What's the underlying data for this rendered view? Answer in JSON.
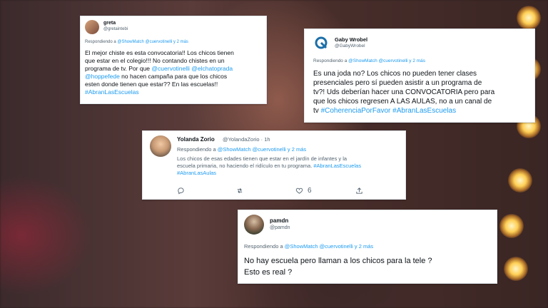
{
  "tweets": {
    "greta": {
      "name": "greta",
      "handle": "@gretaintebi",
      "replying": "Respondiendo a",
      "mentions": "@ShowMatch @cuervotinelli y 2 más",
      "line1": "El mejor chiste es esta convocatoria!! Los chicos tienen",
      "line2": "que estar en el colegio!!! No contando chistes en un",
      "line3_a": "programa de tv. Por que ",
      "line3_m1": "@cuervotinelli",
      "line3_m2": "@elchatoprada",
      "line4_m": "@hoppefede",
      "line4_b": " no hacen campaña para que los chicos",
      "line5": "esten donde tienen que estar?? En las escuelas!!",
      "tag": "#AbranLasEscuelas"
    },
    "gaby": {
      "name": "Gaby Wrobel",
      "handle": "@GabyWrobel",
      "replying": "Respondiendo a",
      "mentions": "@ShowMatch @cuervotinelli y 2 más",
      "line1": "Es una joda no? Los chicos no pueden tener clases",
      "line2": "presenciales pero sí pueden asistir a un programa de",
      "line3": "tv?! Uds deberían hacer una CONVOCATORIA pero para",
      "line4": "que los chicos regresen A LAS AULAS, no a un canal de",
      "line5_a": "tv ",
      "tag1": "#CoherenciaPorFavor",
      "tag2": "#AbranLasEscuelas"
    },
    "yolanda": {
      "name": "Yolanda Zorio",
      "handle": "@YolandaZorio · 1h",
      "replying": "Respondiendo a",
      "mentions": "@ShowMatch @cuervotinelli y 2 más",
      "line1": "Los chicos de esas edades tienen que estar en el jardín de infantes y la",
      "line2_a": "escuela primaria, no haciendo el ridículo en tu programa. ",
      "tag1": "#AbranLasEscuelas",
      "tag2": "#AbranLasAulas",
      "likes": "6"
    },
    "pamdn": {
      "name": "pamdn",
      "handle": "@pamdn",
      "replying": "Respondiendo a",
      "mentions": "@ShowMatch @cuervotinelli y 2 más",
      "line1": "No hay escuela pero llaman a los chicos para la tele ?",
      "line2": "Esto es real ?"
    }
  },
  "colors": {
    "link": "#1d9bf0",
    "muted": "#536471",
    "text": "#0f1419"
  },
  "icons": [
    "reply-icon",
    "retweet-icon",
    "like-icon",
    "share-icon"
  ]
}
